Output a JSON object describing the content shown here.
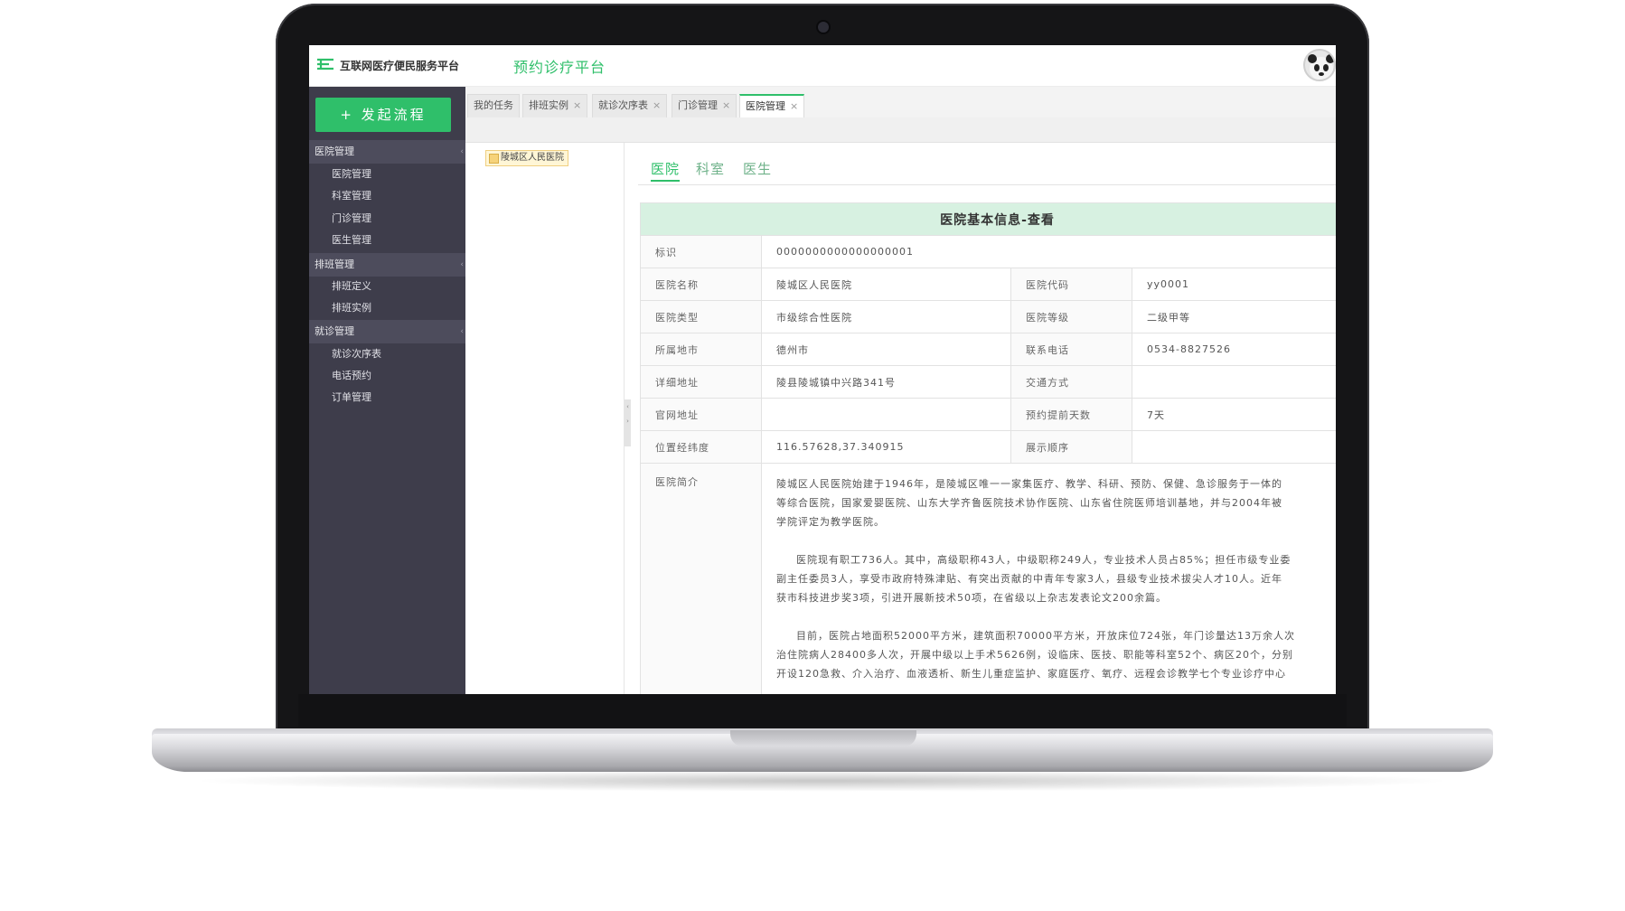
{
  "header": {
    "brand": "互联网医疗便民服务平台",
    "platform": "预约诊疗平台"
  },
  "sidebar": {
    "start_button": "+ 发起流程",
    "groups": [
      {
        "label": "医院管理",
        "items": [
          "医院管理",
          "科室管理",
          "门诊管理",
          "医生管理"
        ]
      },
      {
        "label": "排班管理",
        "items": [
          "排班定义",
          "排班实例"
        ]
      },
      {
        "label": "就诊管理",
        "items": [
          "就诊次序表",
          "电话预约",
          "订单管理"
        ]
      }
    ]
  },
  "tabs": [
    {
      "label": "我的任务",
      "closable": false
    },
    {
      "label": "排班实例",
      "closable": true
    },
    {
      "label": "就诊次序表",
      "closable": true
    },
    {
      "label": "门诊管理",
      "closable": true
    },
    {
      "label": "医院管理",
      "closable": true,
      "active": true
    }
  ],
  "tab_close_glyph": "×",
  "tree": {
    "node": "陵城区人民医院"
  },
  "inner_tabs": [
    "医院",
    "科室",
    "医生"
  ],
  "detail": {
    "title": "医院基本信息-查看",
    "id_label": "标识",
    "id_value": "0000000000000000001",
    "name_label": "医院名称",
    "name_value": "陵城区人民医院",
    "code_label": "医院代码",
    "code_value": "yy0001",
    "type_label": "医院类型",
    "type_value": "市级综合性医院",
    "grade_label": "医院等级",
    "grade_value": "二级甲等",
    "city_label": "所属地市",
    "city_value": "德州市",
    "phone_label": "联系电话",
    "phone_value": "0534-8827526",
    "address_label": "详细地址",
    "address_value": "陵县陵城镇中兴路341号",
    "transport_label": "交通方式",
    "transport_value": "",
    "website_label": "官网地址",
    "website_value": "",
    "advance_label": "预约提前天数",
    "advance_value": "7天",
    "geo_label": "位置经纬度",
    "geo_value": "116.57628,37.340915",
    "order_label": "展示顺序",
    "order_value": "",
    "intro_label": "医院简介",
    "intro": [
      "陵城区人民医院始建于1946年，是陵城区唯一一家集医疗、教学、科研、预防、保健、急诊服务于一体的",
      "等综合医院，国家爱婴医院、山东大学齐鲁医院技术协作医院、山东省住院医师培训基地，并与2004年被",
      "学院评定为教学医院。",
      "医院现有职工736人。其中，高级职称43人，中级职称249人，专业技术人员占85%；担任市级专业委",
      "副主任委员3人，享受市政府特殊津贴、有突出贡献的中青年专家3人，县级专业技术拔尖人才10人。近年",
      "获市科技进步奖3项，引进开展新技术50项，在省级以上杂志发表论文200余篇。",
      "目前，医院占地面积52000平方米，建筑面积70000平方米，开放床位724张，年门诊量达13万余人次",
      "治住院病人28400多人次，开展中级以上手术5626例，设临床、医技、职能等科室52个、病区20个，分别",
      "开设120急救、介入治疗、血液透析、新生儿重症监护、家庭医疗、氧疗、远程会诊教学七个专业诊疗中心"
    ]
  }
}
